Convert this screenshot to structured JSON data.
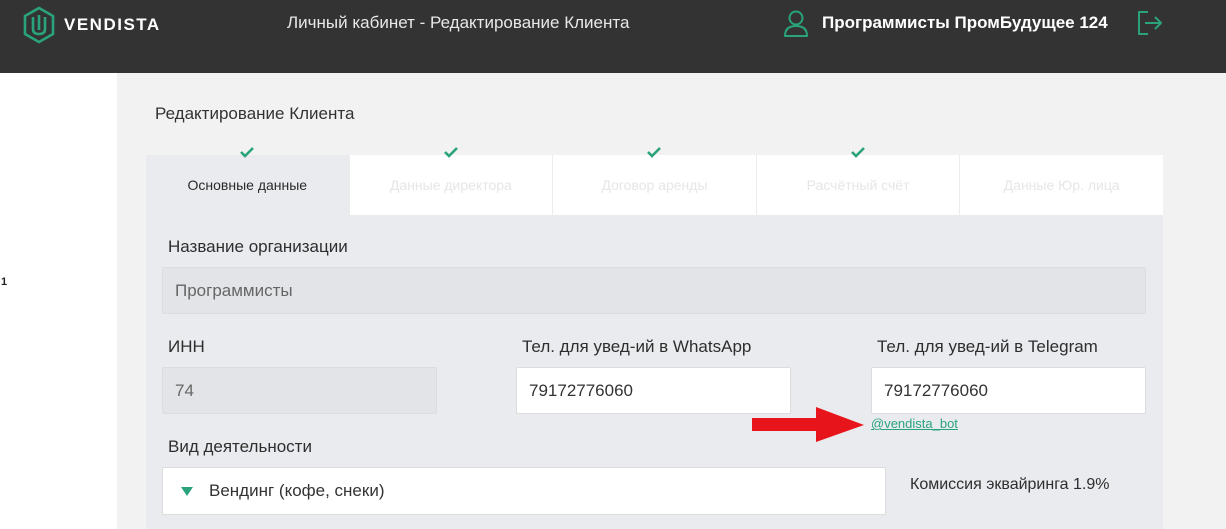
{
  "header": {
    "logo_text": "VENDISTA",
    "title": "Личный кабинет - Редактирование Клиента",
    "user_name": "Программисты ПромБудущее 124",
    "user_icon": "user-icon",
    "logout_icon": "logout-icon"
  },
  "left": {
    "mark": "1"
  },
  "page_title": "Редактирование Клиента",
  "tabs": [
    {
      "label": "Основные данные",
      "active": true
    },
    {
      "label": "Данные директора",
      "active": false
    },
    {
      "label": "Договор аренды",
      "active": false
    },
    {
      "label": "Расчётный счёт",
      "active": false
    },
    {
      "label": "Данные Юр. лица",
      "active": false
    }
  ],
  "form": {
    "org_name_label": "Название организации",
    "org_name_value": "Программисты",
    "inn_label": "ИНН",
    "inn_value": "74",
    "whatsapp_label": "Тел. для увед-ий в WhatsApp",
    "whatsapp_value": "79172776060",
    "telegram_label": "Тел. для увед-ий в Telegram",
    "telegram_value": "79172776060",
    "telegram_bot_link": "@vendista_bot",
    "activity_label": "Вид деятельности",
    "activity_value": "Вендинг (кофе, снеки)",
    "commission": "Комиссия эквайринга 1.9%"
  },
  "colors": {
    "accent": "#2aa37d",
    "header_bg": "#333333",
    "annotation_arrow": "#e8141b"
  }
}
